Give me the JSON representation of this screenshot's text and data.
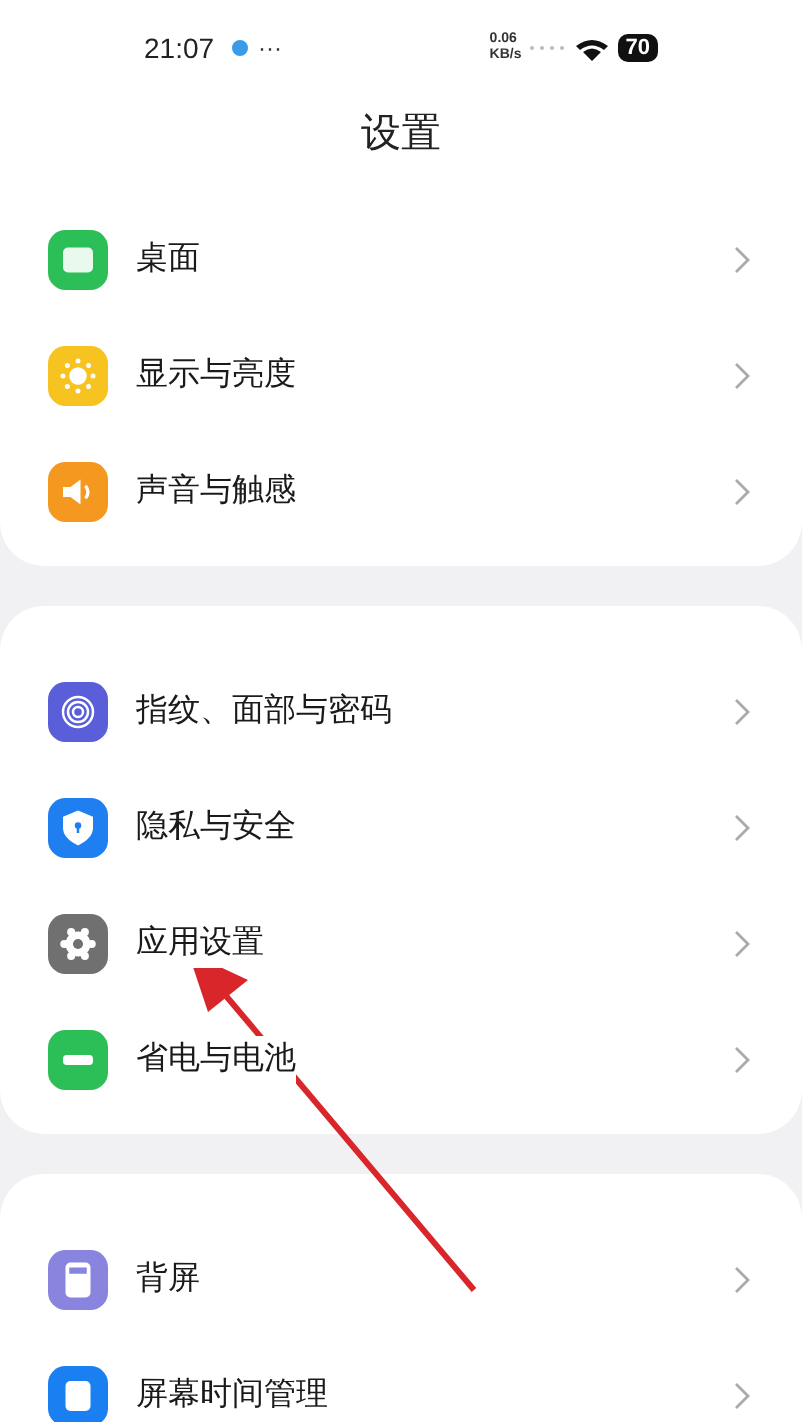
{
  "status_bar": {
    "time": "21:07",
    "more": "···",
    "speed_value": "0.06",
    "speed_unit": "KB/s",
    "battery": "70"
  },
  "title": "设置",
  "sections": [
    {
      "items": [
        {
          "label": "桌面"
        },
        {
          "label": "显示与亮度"
        },
        {
          "label": "声音与触感"
        }
      ]
    },
    {
      "items": [
        {
          "label": "指纹、面部与密码"
        },
        {
          "label": "隐私与安全"
        },
        {
          "label": "应用设置"
        },
        {
          "label": "省电与电池"
        }
      ]
    },
    {
      "items": [
        {
          "label": "背屏"
        },
        {
          "label": "屏幕时间管理"
        }
      ]
    }
  ]
}
